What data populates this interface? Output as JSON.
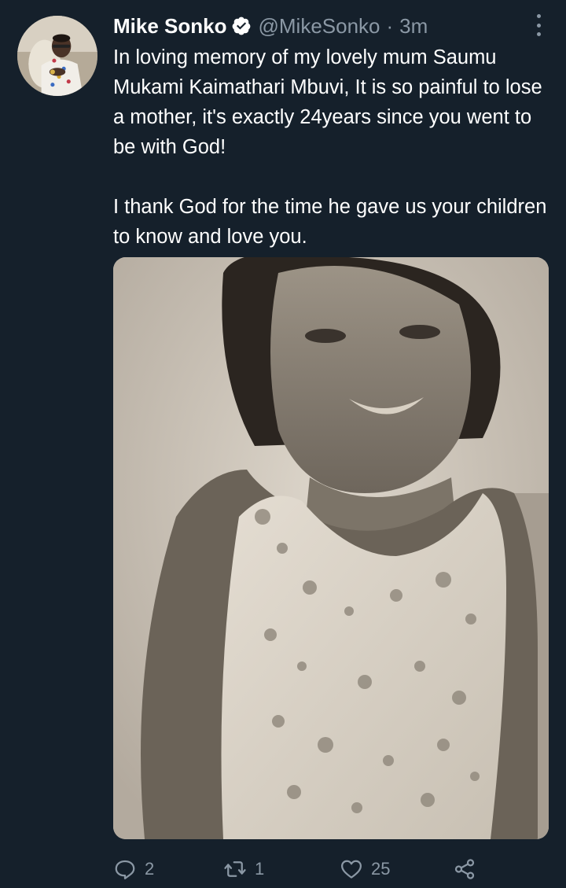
{
  "tweet": {
    "author_name": "Mike Sonko",
    "handle": "@MikeSonko",
    "separator": "·",
    "time": "3m",
    "paragraph_1": "In loving memory of my lovely mum Saumu Mukami Kaimathari Mbuvi, It is so painful to lose a mother, it's exactly 24years since you went to be with God!",
    "paragraph_2": "I thank God for the time he gave us your children to know and love you."
  },
  "actions": {
    "replies": "2",
    "retweets": "1",
    "likes": "25"
  },
  "icons": {
    "verified": "verified-badge-icon",
    "more": "more-vertical-icon",
    "reply": "reply-icon",
    "retweet": "retweet-icon",
    "like": "heart-icon",
    "share": "share-icon"
  },
  "colors": {
    "background": "#15202b",
    "text": "#ffffff",
    "secondary_text": "#8b98a5",
    "verified": "#ffffff"
  }
}
